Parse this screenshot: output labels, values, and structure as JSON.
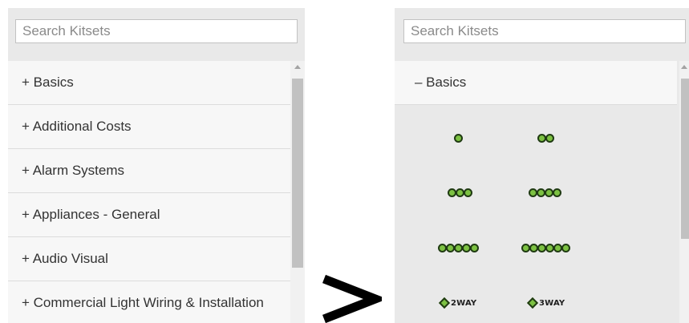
{
  "left_panel": {
    "search": {
      "placeholder": "Search Kitsets"
    },
    "items": [
      {
        "label": "+ Basics"
      },
      {
        "label": "+ Additional Costs"
      },
      {
        "label": "+ Alarm Systems"
      },
      {
        "label": "+ Appliances - General"
      },
      {
        "label": "+ Audio Visual"
      },
      {
        "label": "+ Commercial Light Wiring & Installation"
      }
    ]
  },
  "transition": {
    "symbol": ">"
  },
  "right_panel": {
    "search": {
      "placeholder": "Search Kitsets"
    },
    "expanded_item": {
      "label": "– Basics"
    },
    "kitsets": [
      {
        "icon": "one-dot-icon",
        "dots": 1
      },
      {
        "icon": "two-dot-icon",
        "dots": 2
      },
      {
        "icon": "three-dot-icon",
        "dots": 3
      },
      {
        "icon": "four-dot-icon",
        "dots": 4
      },
      {
        "icon": "five-dot-icon",
        "dots": 5
      },
      {
        "icon": "six-dot-icon",
        "dots": 6
      },
      {
        "icon": "two-way-switch-icon",
        "label": "2WAY"
      },
      {
        "icon": "three-way-switch-icon",
        "label": "3WAY"
      }
    ]
  },
  "colors": {
    "dot_fill": "#7cc142",
    "dot_border": "#1f3a12",
    "panel_bg": "#e9e9e9"
  }
}
